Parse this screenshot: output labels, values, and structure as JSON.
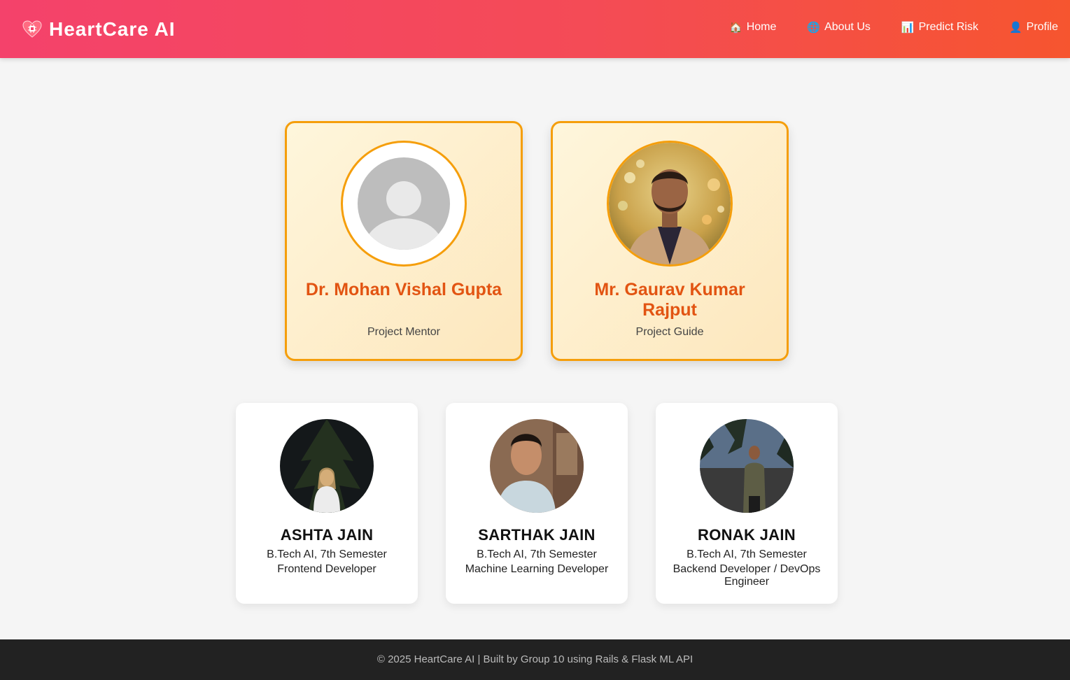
{
  "app": {
    "title": "HeartCare AI",
    "logo_icon": "heart-chip-icon"
  },
  "nav": {
    "items": [
      {
        "icon": "🏠",
        "icon_name": "home-icon",
        "label": "Home"
      },
      {
        "icon": "🌐",
        "icon_name": "globe-icon",
        "label": "About Us"
      },
      {
        "icon": "📊",
        "icon_name": "chart-icon",
        "label": "Predict Risk"
      },
      {
        "icon": "👤",
        "icon_name": "user-icon",
        "label": "Profile"
      }
    ]
  },
  "mentors": [
    {
      "name": "Dr. Mohan Vishal Gupta",
      "role": "Project Mentor",
      "photo": "placeholder-avatar"
    },
    {
      "name": "Mr. Gaurav Kumar Rajput",
      "role": "Project Guide",
      "photo": "portrait-photo"
    }
  ],
  "students": [
    {
      "name": "ASHTA JAIN",
      "course": "B.Tech AI, 7th Semester",
      "role": "Frontend Developer"
    },
    {
      "name": "SARTHAK JAIN",
      "course": "B.Tech AI, 7th Semester",
      "role": "Machine Learning Developer"
    },
    {
      "name": "RONAK JAIN",
      "course": "B.Tech AI, 7th Semester",
      "role": "Backend Developer / DevOps Engineer"
    }
  ],
  "footer": {
    "text": "© 2025 HeartCare AI | Built by Group 10 using Rails & Flask ML API"
  },
  "colors": {
    "nav_gradient_start": "#f4426b",
    "nav_gradient_end": "#f6552f",
    "mentor_accent": "#f59e0b",
    "mentor_name": "#e25412",
    "footer_bg": "#222222"
  }
}
